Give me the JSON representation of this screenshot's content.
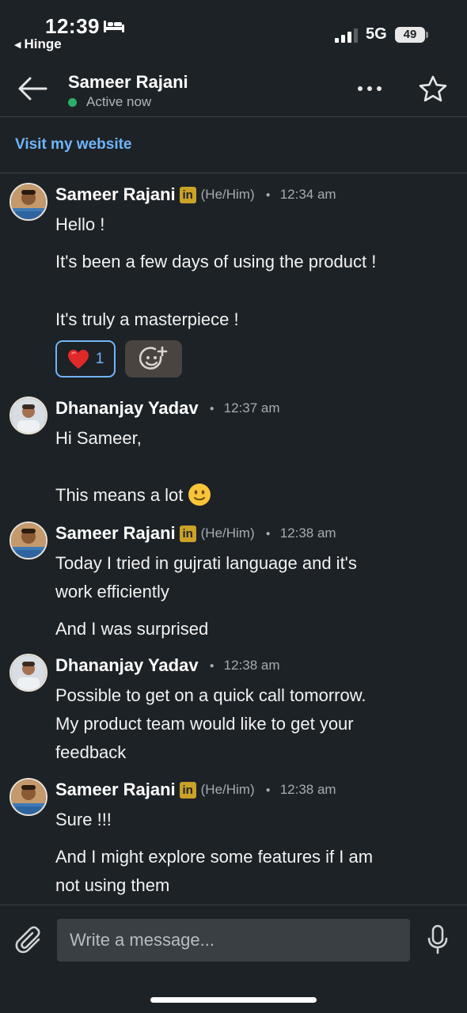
{
  "status_bar": {
    "time": "12:39",
    "back_app": "Hinge",
    "network": "5G",
    "battery": "49",
    "icons": [
      "bed-icon",
      "signal-icon",
      "battery-icon"
    ]
  },
  "header": {
    "name": "Sameer Rajani",
    "presence": "Active now",
    "presence_color": "#2aaf6a",
    "icons": [
      "back-arrow-icon",
      "more-icon",
      "star-icon"
    ]
  },
  "website_link": "Visit my website",
  "colors": {
    "background": "#1d2226",
    "link": "#70b5f9",
    "linkedin_badge": "#c9a227"
  },
  "messages": [
    {
      "sender": "Sameer Rajani",
      "badge": "in",
      "pronouns": "(He/Him)",
      "time": "12:34 am",
      "lines": [
        "Hello !",
        "It's been a few days of using the product !",
        "It's truly a masterpiece !"
      ],
      "reaction": {
        "emoji": "heart",
        "count": "1"
      }
    },
    {
      "sender": "Dhananjay Yadav",
      "time": "12:37 am",
      "lines": [
        "Hi Sameer,",
        "This means a lot"
      ]
    },
    {
      "sender": "Sameer Rajani",
      "badge": "in",
      "pronouns": "(He/Him)",
      "time": "12:38 am",
      "lines": [
        "Today I tried in gujrati language and it's",
        "work efficiently",
        "And I was surprised"
      ]
    },
    {
      "sender": "Dhananjay Yadav",
      "time": "12:38 am",
      "lines": [
        "Possible to get on a quick call tomorrow.",
        "My product team would like to get your",
        "feedback"
      ]
    },
    {
      "sender": "Sameer Rajani",
      "badge": "in",
      "pronouns": "(He/Him)",
      "time": "12:38 am",
      "lines": [
        "Sure !!!",
        "And I might explore some features if I am",
        "not using them"
      ]
    }
  ],
  "composer": {
    "placeholder": "Write a message...",
    "icons": [
      "paperclip-icon",
      "microphone-icon"
    ]
  }
}
